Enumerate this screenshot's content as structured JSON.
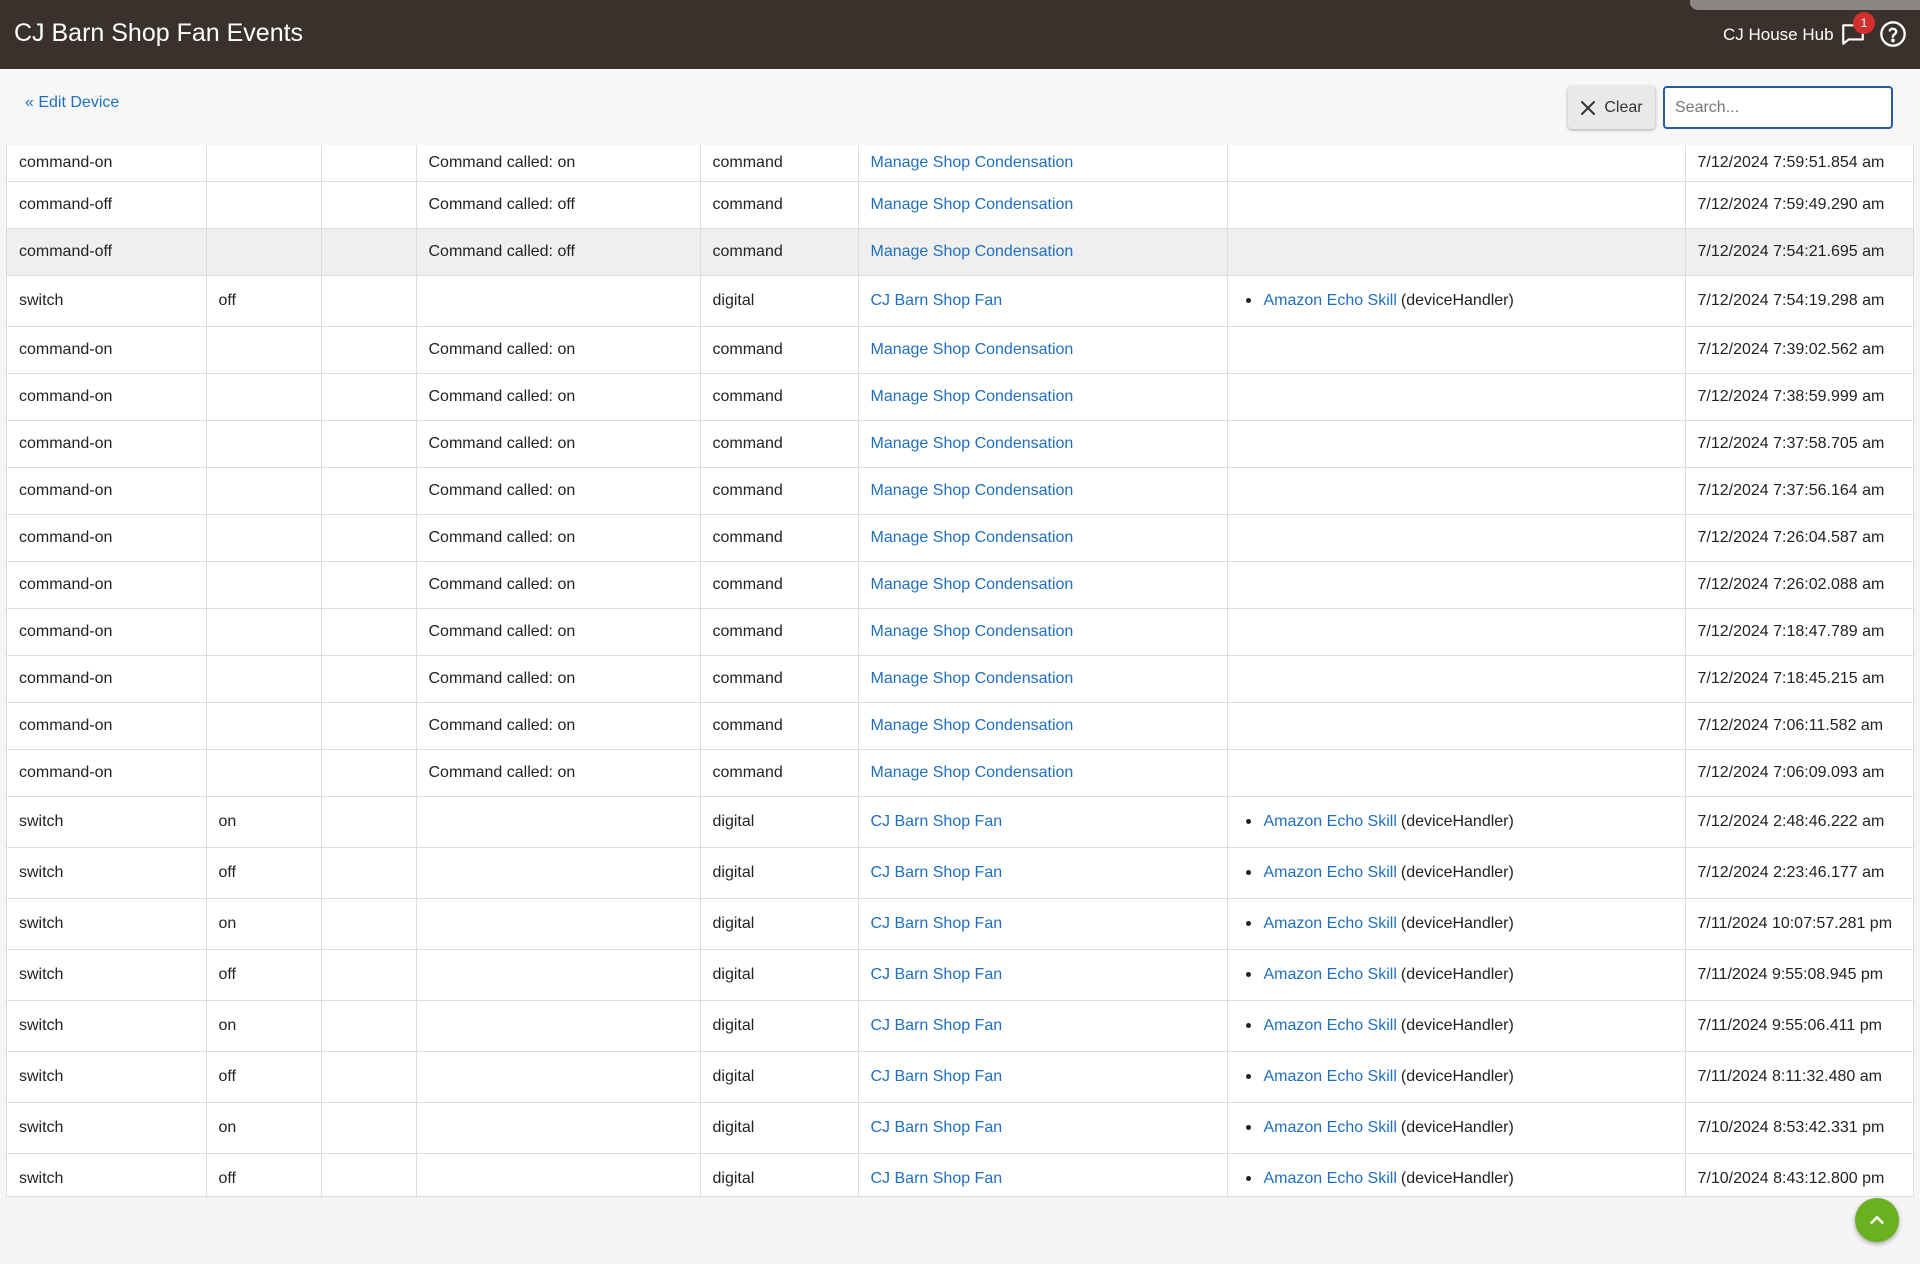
{
  "header": {
    "title": "CJ Barn Shop Fan Events",
    "hub_name": "CJ House Hub",
    "notification_count": "1",
    "notification_icon": "chat-bubble-icon",
    "help_icon": "help-circle-icon"
  },
  "toolbar": {
    "edit_device_link": "« Edit Device",
    "clear_label": "Clear",
    "search_placeholder": "Search...",
    "search_value": ""
  },
  "events": [
    {
      "name": "command-on",
      "value": "",
      "unit": "",
      "description": "Command called: on",
      "type": "command",
      "source": "Manage Shop Condensation",
      "handler": "",
      "handler_suffix": "",
      "date": "7/12/2024 7:59:51.854 am"
    },
    {
      "name": "command-off",
      "value": "",
      "unit": "",
      "description": "Command called: off",
      "type": "command",
      "source": "Manage Shop Condensation",
      "handler": "",
      "handler_suffix": "",
      "date": "7/12/2024 7:59:49.290 am"
    },
    {
      "name": "command-off",
      "value": "",
      "unit": "",
      "description": "Command called: off",
      "type": "command",
      "source": "Manage Shop Condensation",
      "handler": "",
      "handler_suffix": "",
      "date": "7/12/2024 7:54:21.695 am"
    },
    {
      "name": "switch",
      "value": "off",
      "unit": "",
      "description": "",
      "type": "digital",
      "source": "CJ Barn Shop Fan",
      "handler": "Amazon Echo Skill",
      "handler_suffix": "(deviceHandler)",
      "date": "7/12/2024 7:54:19.298 am"
    },
    {
      "name": "command-on",
      "value": "",
      "unit": "",
      "description": "Command called: on",
      "type": "command",
      "source": "Manage Shop Condensation",
      "handler": "",
      "handler_suffix": "",
      "date": "7/12/2024 7:39:02.562 am"
    },
    {
      "name": "command-on",
      "value": "",
      "unit": "",
      "description": "Command called: on",
      "type": "command",
      "source": "Manage Shop Condensation",
      "handler": "",
      "handler_suffix": "",
      "date": "7/12/2024 7:38:59.999 am"
    },
    {
      "name": "command-on",
      "value": "",
      "unit": "",
      "description": "Command called: on",
      "type": "command",
      "source": "Manage Shop Condensation",
      "handler": "",
      "handler_suffix": "",
      "date": "7/12/2024 7:37:58.705 am"
    },
    {
      "name": "command-on",
      "value": "",
      "unit": "",
      "description": "Command called: on",
      "type": "command",
      "source": "Manage Shop Condensation",
      "handler": "",
      "handler_suffix": "",
      "date": "7/12/2024 7:37:56.164 am"
    },
    {
      "name": "command-on",
      "value": "",
      "unit": "",
      "description": "Command called: on",
      "type": "command",
      "source": "Manage Shop Condensation",
      "handler": "",
      "handler_suffix": "",
      "date": "7/12/2024 7:26:04.587 am"
    },
    {
      "name": "command-on",
      "value": "",
      "unit": "",
      "description": "Command called: on",
      "type": "command",
      "source": "Manage Shop Condensation",
      "handler": "",
      "handler_suffix": "",
      "date": "7/12/2024 7:26:02.088 am"
    },
    {
      "name": "command-on",
      "value": "",
      "unit": "",
      "description": "Command called: on",
      "type": "command",
      "source": "Manage Shop Condensation",
      "handler": "",
      "handler_suffix": "",
      "date": "7/12/2024 7:18:47.789 am"
    },
    {
      "name": "command-on",
      "value": "",
      "unit": "",
      "description": "Command called: on",
      "type": "command",
      "source": "Manage Shop Condensation",
      "handler": "",
      "handler_suffix": "",
      "date": "7/12/2024 7:18:45.215 am"
    },
    {
      "name": "command-on",
      "value": "",
      "unit": "",
      "description": "Command called: on",
      "type": "command",
      "source": "Manage Shop Condensation",
      "handler": "",
      "handler_suffix": "",
      "date": "7/12/2024 7:06:11.582 am"
    },
    {
      "name": "command-on",
      "value": "",
      "unit": "",
      "description": "Command called: on",
      "type": "command",
      "source": "Manage Shop Condensation",
      "handler": "",
      "handler_suffix": "",
      "date": "7/12/2024 7:06:09.093 am"
    },
    {
      "name": "switch",
      "value": "on",
      "unit": "",
      "description": "",
      "type": "digital",
      "source": "CJ Barn Shop Fan",
      "handler": "Amazon Echo Skill",
      "handler_suffix": "(deviceHandler)",
      "date": "7/12/2024 2:48:46.222 am"
    },
    {
      "name": "switch",
      "value": "off",
      "unit": "",
      "description": "",
      "type": "digital",
      "source": "CJ Barn Shop Fan",
      "handler": "Amazon Echo Skill",
      "handler_suffix": "(deviceHandler)",
      "date": "7/12/2024 2:23:46.177 am"
    },
    {
      "name": "switch",
      "value": "on",
      "unit": "",
      "description": "",
      "type": "digital",
      "source": "CJ Barn Shop Fan",
      "handler": "Amazon Echo Skill",
      "handler_suffix": "(deviceHandler)",
      "date": "7/11/2024 10:07:57.281 pm"
    },
    {
      "name": "switch",
      "value": "off",
      "unit": "",
      "description": "",
      "type": "digital",
      "source": "CJ Barn Shop Fan",
      "handler": "Amazon Echo Skill",
      "handler_suffix": "(deviceHandler)",
      "date": "7/11/2024 9:55:08.945 pm"
    },
    {
      "name": "switch",
      "value": "on",
      "unit": "",
      "description": "",
      "type": "digital",
      "source": "CJ Barn Shop Fan",
      "handler": "Amazon Echo Skill",
      "handler_suffix": "(deviceHandler)",
      "date": "7/11/2024 9:55:06.411 pm"
    },
    {
      "name": "switch",
      "value": "off",
      "unit": "",
      "description": "",
      "type": "digital",
      "source": "CJ Barn Shop Fan",
      "handler": "Amazon Echo Skill",
      "handler_suffix": "(deviceHandler)",
      "date": "7/11/2024 8:11:32.480 am"
    },
    {
      "name": "switch",
      "value": "on",
      "unit": "",
      "description": "",
      "type": "digital",
      "source": "CJ Barn Shop Fan",
      "handler": "Amazon Echo Skill",
      "handler_suffix": "(deviceHandler)",
      "date": "7/10/2024 8:53:42.331 pm"
    },
    {
      "name": "switch",
      "value": "off",
      "unit": "",
      "description": "",
      "type": "digital",
      "source": "CJ Barn Shop Fan",
      "handler": "Amazon Echo Skill",
      "handler_suffix": "(deviceHandler)",
      "date": "7/10/2024 8:43:12.800 pm"
    }
  ],
  "highlighted_row": 2,
  "colors": {
    "header_bg": "#3a302c",
    "link": "#1f6fbf",
    "badge": "#d32f2f",
    "fab": "#6ab120",
    "search_border": "#2c5aa0"
  },
  "fab_icon": "chevron-up-icon"
}
